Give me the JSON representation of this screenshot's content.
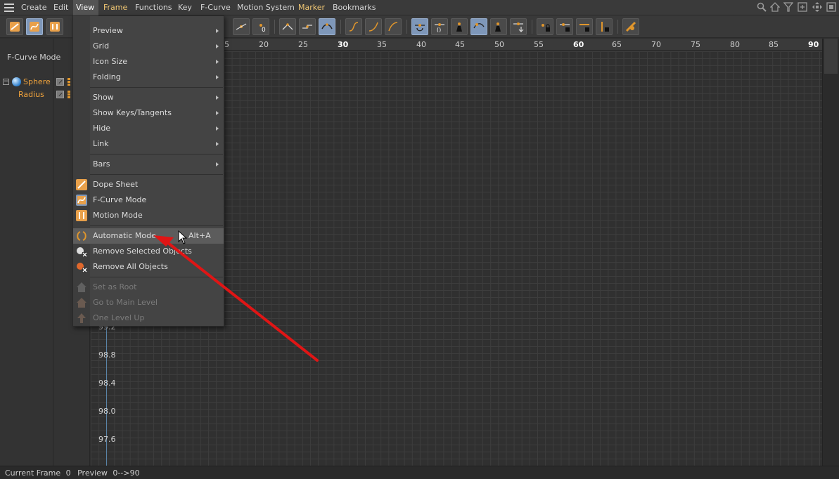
{
  "menubar": {
    "items": [
      {
        "label": "Create"
      },
      {
        "label": "Edit"
      },
      {
        "label": "View"
      },
      {
        "label": "Frame"
      },
      {
        "label": "Functions"
      },
      {
        "label": "Key"
      },
      {
        "label": "F-Curve"
      },
      {
        "label": "Motion System"
      },
      {
        "label": "Marker"
      },
      {
        "label": "Bookmarks"
      }
    ],
    "right_icons": [
      "search-icon",
      "home-icon",
      "filter-icon",
      "new-window-icon",
      "move-icon",
      "expand-icon"
    ]
  },
  "left_panel": {
    "mode_label": "F-Curve Mode",
    "tree": [
      {
        "label": "Sphere",
        "icon": "sphere-icon"
      },
      {
        "label": "Radius"
      }
    ]
  },
  "ruler": {
    "ticks": [
      5,
      20,
      25,
      30,
      35,
      40,
      45,
      50,
      55,
      60,
      65,
      70,
      75,
      80,
      85,
      90
    ],
    "bold_ticks": [
      30,
      60,
      90
    ]
  },
  "graph": {
    "y_labels": [
      "99.2",
      "98.8",
      "98.4",
      "98.0",
      "97.6"
    ]
  },
  "status": {
    "current_frame_label": "Current Frame",
    "current_frame_value": "0",
    "preview_label": "Preview",
    "preview_range": "0-->90"
  },
  "dropdown": {
    "items": [
      {
        "label": "Preview",
        "submenu": true
      },
      {
        "label": "Grid",
        "submenu": true
      },
      {
        "label": "Icon Size",
        "submenu": true
      },
      {
        "label": "Folding",
        "submenu": true
      },
      {
        "label": "Show",
        "submenu": true
      },
      {
        "label": "Show Keys/Tangents",
        "submenu": true
      },
      {
        "label": "Hide",
        "submenu": true
      },
      {
        "label": "Link",
        "submenu": true
      },
      {
        "label": "Bars",
        "submenu": true
      },
      {
        "label": "Dope Sheet",
        "icon": "dope-sheet-icon"
      },
      {
        "label": "F-Curve Mode",
        "icon": "f-curve-mode-icon"
      },
      {
        "label": "Motion Mode",
        "icon": "motion-mode-icon"
      },
      {
        "label": "Automatic Mode",
        "icon": "automatic-mode-icon",
        "shortcut": "Alt+A",
        "highlighted": true
      },
      {
        "label": "Remove Selected Objects",
        "icon": "remove-selected-icon"
      },
      {
        "label": "Remove All Objects",
        "icon": "remove-all-icon"
      },
      {
        "label": "Set as Root",
        "icon": "set-root-icon",
        "disabled": true
      },
      {
        "label": "Go to Main Level",
        "icon": "main-level-icon",
        "disabled": true
      },
      {
        "label": "One Level Up",
        "icon": "level-up-icon",
        "disabled": true
      }
    ]
  },
  "colors": {
    "accent_orange": "#f0a33c",
    "selected_tool": "#7e97b9",
    "annotation_arrow": "#e01515"
  }
}
